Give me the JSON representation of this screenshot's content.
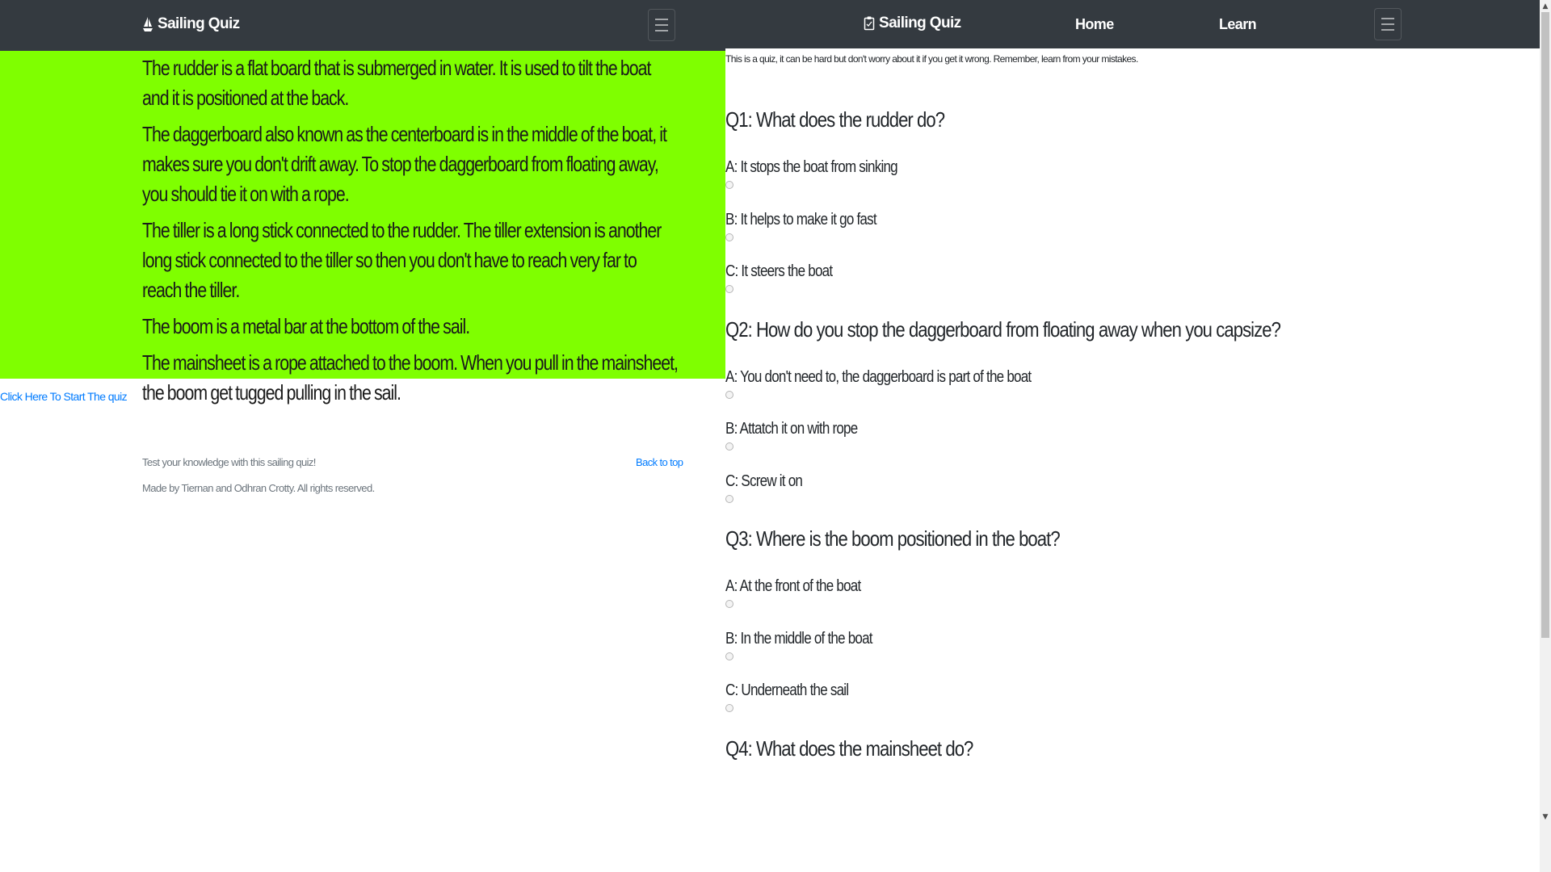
{
  "left": {
    "navbar": {
      "brand": "Sailing Quiz",
      "brand_icon": "sailboat-icon",
      "toggler_icon": "hamburger-menu-icon"
    },
    "info": [
      "The rudder is a flat board that is submerged in water. It is used to tilt the boat and it is positioned at the back.",
      "The daggerboard also known as the centerboard is in the middle of the boat, it makes sure you don't drift away. To stop the daggerboard from floating away, you should tie it on with a rope.",
      "The tiller is a long stick connected to the rudder. The tiller extension is another long stick connected to the tiller so then you don't have to reach very far to reach the tiller.",
      "The boom is a metal bar at the bottom of the sail.",
      "The mainsheet is a rope attached to the boom. When you pull in the mainsheet, the boom get tugged pulling in the sail."
    ],
    "start_link": "Click Here To Start The quiz",
    "footer": {
      "tagline": "Test your knowledge with this sailing quiz!",
      "credit": "Made by Tiernan and Odhran Crotty. All rights reserved.",
      "back_to_top": "Back to top"
    }
  },
  "right": {
    "navbar": {
      "brand": "Sailing Quiz",
      "brand_icon": "clipboard-icon",
      "home": "Home",
      "learn": "Learn",
      "toggler_icon": "hamburger-menu-icon"
    },
    "intro": "This is a quiz, it can be hard but don't worry about it if you get it wrong. Remember, learn from your mistakes.",
    "questions": [
      {
        "text": "Q1: What does the rudder do?",
        "options": [
          "A: It stops the boat from sinking",
          "B: It helps to make it go fast",
          "C: It steers the boat"
        ]
      },
      {
        "text": "Q2: How do you stop the daggerboard from floating away when you capsize?",
        "options": [
          "A: You don't need to, the daggerboard is part of the boat",
          "B: Attatch it on with rope",
          "C: Screw it on"
        ]
      },
      {
        "text": "Q3: Where is the boom positioned in the boat?",
        "options": [
          "A: At the front of the boat",
          "B: In the middle of the boat",
          "C: Underneath the sail"
        ]
      },
      {
        "text": "Q4: What does the mainsheet do?",
        "options": []
      }
    ]
  },
  "colors": {
    "navbar": "#343a40",
    "info_background": "#7fff00",
    "link": "#007bff",
    "muted": "#6c757d"
  }
}
